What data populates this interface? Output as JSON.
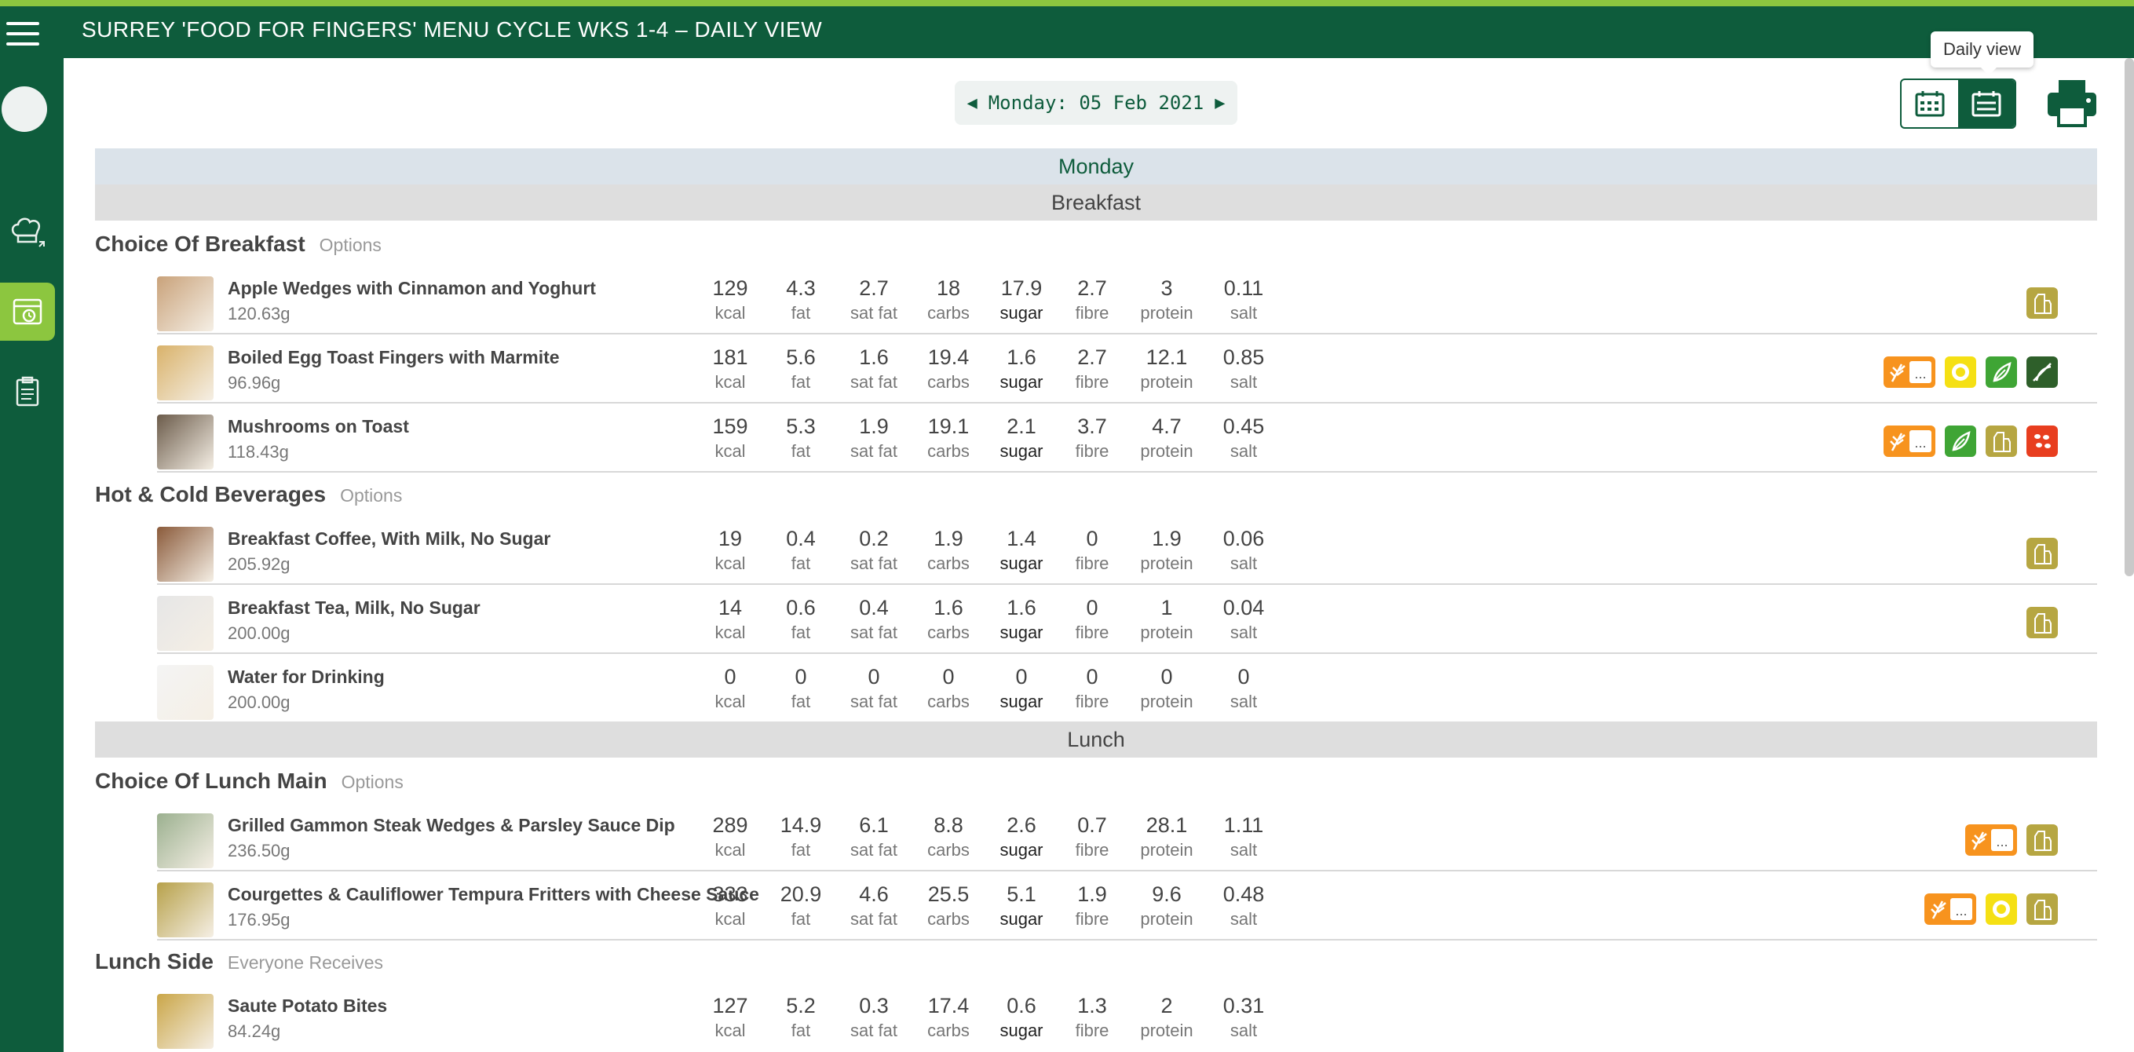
{
  "app": {
    "title": "SURREY 'FOOD FOR FINGERS' MENU CYCLE WKS 1-4 – DAILY VIEW"
  },
  "nav": {
    "date_label": "Monday: 05 Feb 2021",
    "tooltip": "Daily view"
  },
  "colors": {
    "brand": "#0e5c3c",
    "accent": "#8cc63f",
    "gluten": "#f7931e",
    "egg": "#f5e014",
    "veg": "#3fa535",
    "vegan": "#2e5f2a",
    "milk": "#b6a642",
    "soya": "#e83e1f"
  },
  "day": "Monday",
  "units": {
    "kcal": "kcal",
    "fat": "fat",
    "satfat": "sat fat",
    "carbs": "carbs",
    "sugar": "sugar",
    "fibre": "fibre",
    "protein": "protein",
    "salt": "salt"
  },
  "meals": {
    "breakfast": {
      "label": "Breakfast",
      "sections": [
        {
          "title": "Choice Of Breakfast",
          "sub": "Options",
          "items": [
            {
              "name": "Apple Wedges with Cinnamon and Yoghurt",
              "weight": "120.63g",
              "kcal": "129",
              "fat": "4.3",
              "satfat": "2.7",
              "carbs": "18",
              "sugar": "17.9",
              "fibre": "2.7",
              "protein": "3",
              "salt": "0.11",
              "allergens": [
                "milk"
              ]
            },
            {
              "name": "Boiled Egg Toast Fingers with Marmite",
              "weight": "96.96g",
              "kcal": "181",
              "fat": "5.6",
              "satfat": "1.6",
              "carbs": "19.4",
              "sugar": "1.6",
              "fibre": "2.7",
              "protein": "12.1",
              "salt": "0.85",
              "allergens": [
                "gluten",
                "egg",
                "veg",
                "vegan"
              ]
            },
            {
              "name": "Mushrooms on Toast",
              "weight": "118.43g",
              "kcal": "159",
              "fat": "5.3",
              "satfat": "1.9",
              "carbs": "19.1",
              "sugar": "2.1",
              "fibre": "3.7",
              "protein": "4.7",
              "salt": "0.45",
              "allergens": [
                "gluten",
                "veg",
                "milk",
                "soya"
              ]
            }
          ]
        },
        {
          "title": "Hot & Cold Beverages",
          "sub": "Options",
          "items": [
            {
              "name": "Breakfast Coffee, With Milk, No Sugar",
              "weight": "205.92g",
              "kcal": "19",
              "fat": "0.4",
              "satfat": "0.2",
              "carbs": "1.9",
              "sugar": "1.4",
              "fibre": "0",
              "protein": "1.9",
              "salt": "0.06",
              "allergens": [
                "milk"
              ]
            },
            {
              "name": "Breakfast Tea, Milk, No Sugar",
              "weight": "200.00g",
              "kcal": "14",
              "fat": "0.6",
              "satfat": "0.4",
              "carbs": "1.6",
              "sugar": "1.6",
              "fibre": "0",
              "protein": "1",
              "salt": "0.04",
              "allergens": [
                "milk"
              ]
            },
            {
              "name": "Water for Drinking",
              "weight": "200.00g",
              "kcal": "0",
              "fat": "0",
              "satfat": "0",
              "carbs": "0",
              "sugar": "0",
              "fibre": "0",
              "protein": "0",
              "salt": "0",
              "allergens": []
            }
          ]
        }
      ]
    },
    "lunch": {
      "label": "Lunch",
      "sections": [
        {
          "title": "Choice Of Lunch Main",
          "sub": "Options",
          "items": [
            {
              "name": "Grilled Gammon Steak Wedges & Parsley Sauce Dip",
              "weight": "236.50g",
              "kcal": "289",
              "fat": "14.9",
              "satfat": "6.1",
              "carbs": "8.8",
              "sugar": "2.6",
              "fibre": "0.7",
              "protein": "28.1",
              "salt": "1.11",
              "allergens": [
                "gluten",
                "milk"
              ]
            },
            {
              "name": "Courgettes & Cauliflower Tempura Fritters with Cheese Sauce",
              "weight": "176.95g",
              "kcal": "333",
              "fat": "20.9",
              "satfat": "4.6",
              "carbs": "25.5",
              "sugar": "5.1",
              "fibre": "1.9",
              "protein": "9.6",
              "salt": "0.48",
              "allergens": [
                "gluten",
                "egg",
                "milk"
              ]
            }
          ]
        },
        {
          "title": "Lunch Side",
          "sub": "Everyone Receives",
          "items": [
            {
              "name": "Saute Potato Bites",
              "weight": "84.24g",
              "kcal": "127",
              "fat": "5.2",
              "satfat": "0.3",
              "carbs": "17.4",
              "sugar": "0.6",
              "fibre": "1.3",
              "protein": "2",
              "salt": "0.31",
              "allergens": []
            }
          ]
        }
      ]
    }
  }
}
